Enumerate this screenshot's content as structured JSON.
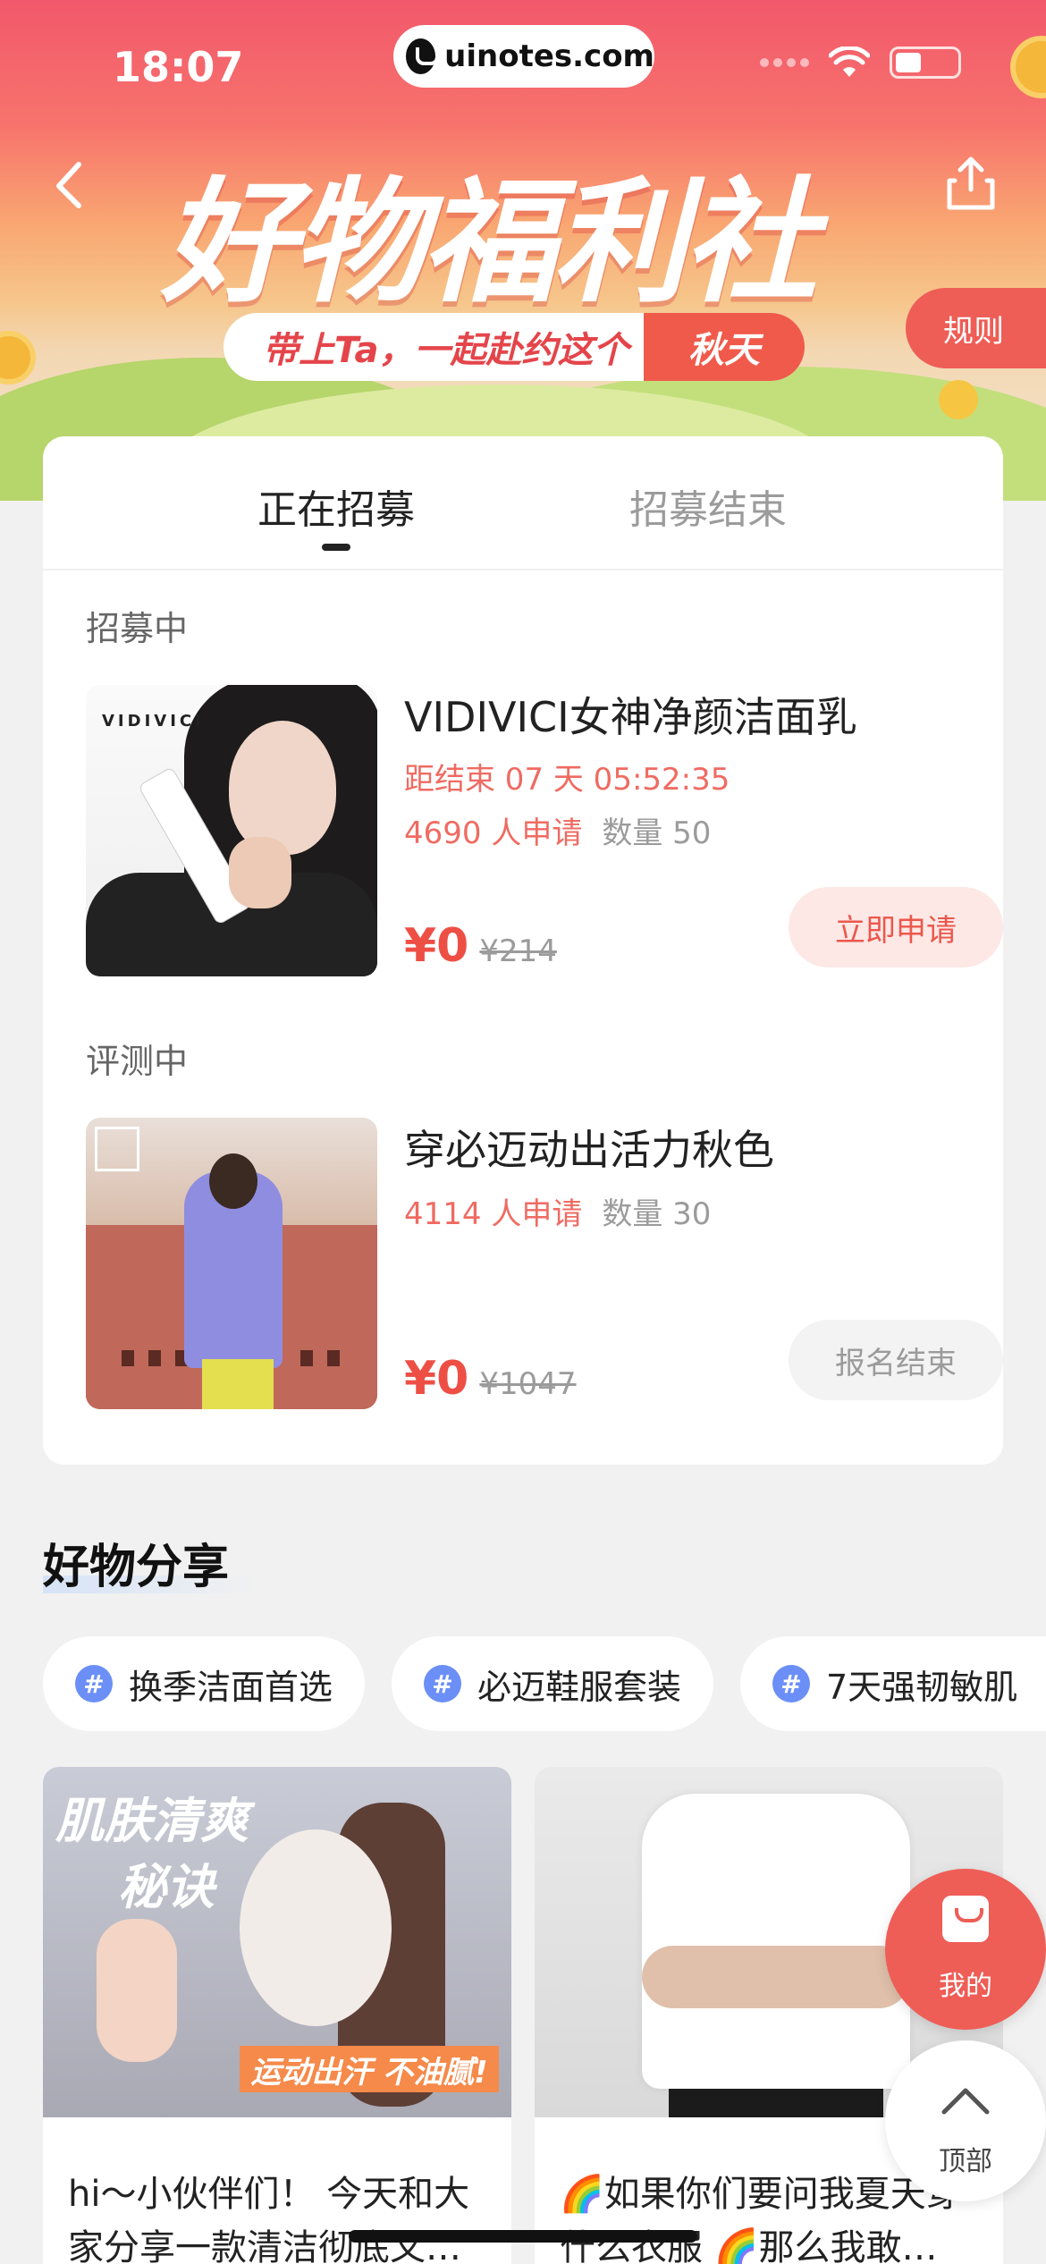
{
  "status_bar": {
    "time": "18:07",
    "url": "uinotes.com"
  },
  "header": {
    "title": "好物福利社",
    "subtitle": "带上Ta，一起赴约这个",
    "subtitle_highlight": "秋天",
    "rules_label": "规则"
  },
  "tabs": [
    {
      "label": "正在招募",
      "active": true
    },
    {
      "label": "招募结束",
      "active": false
    }
  ],
  "sections": {
    "recruiting_label": "招募中",
    "reviewing_label": "评测中"
  },
  "products": [
    {
      "name": "VIDIVICI女神净颜洁面乳",
      "brand_text": "VIDIVICI",
      "countdown": "距结束 07 天 05:52:35",
      "applicants": "4690 人申请",
      "quantity": "数量 50",
      "price": "¥0",
      "original_price": "¥214",
      "cta": "立即申请"
    },
    {
      "name": "穿必迈动出活力秋色",
      "applicants": "4114 人申请",
      "quantity": "数量 30",
      "price": "¥0",
      "original_price": "¥1047",
      "cta": "报名结束"
    }
  ],
  "share": {
    "title": "好物分享",
    "chips": [
      "换季洁面首选",
      "必迈鞋服套装",
      "7天强韧敏肌"
    ],
    "posts": [
      {
        "overlay_line1": "肌肤清爽",
        "overlay_line2": "秘诀",
        "overlay_tag": "运动出汗 不油腻!",
        "text": "hi～小伙伴们！ 今天和大家分享一款清洁彻底又…"
      },
      {
        "text": "🌈如果你们要问我夏天穿什么衣服 🌈那么我敢…"
      }
    ]
  },
  "floating": {
    "mine_label": "我的",
    "top_label": "顶部"
  },
  "colors": {
    "accent": "#ee5d56",
    "price": "#ee4f45",
    "chip_hash": "#6b8ff6"
  }
}
